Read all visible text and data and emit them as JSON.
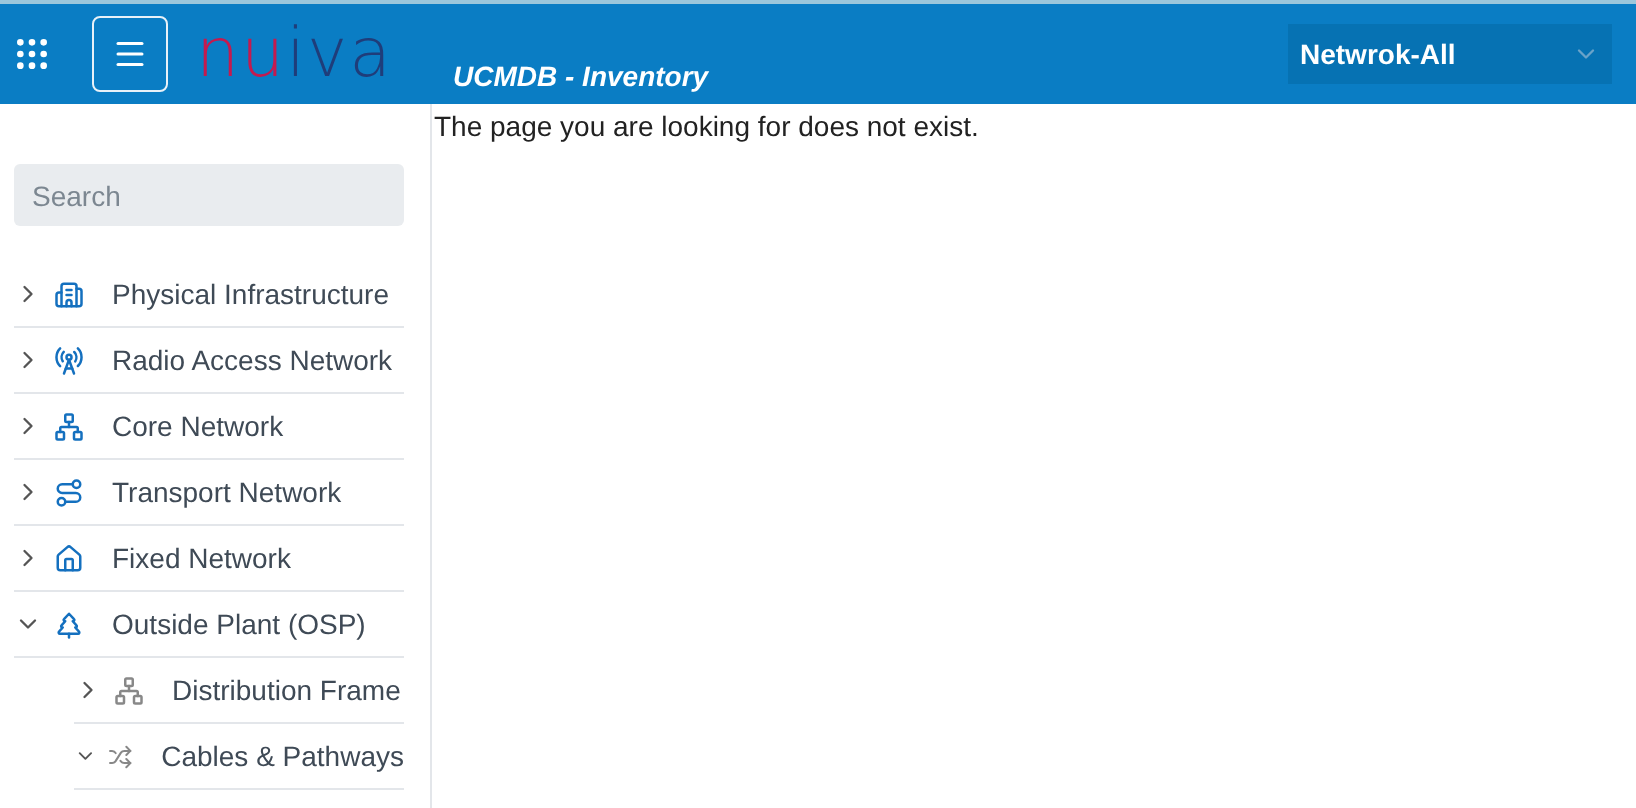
{
  "header": {
    "logo": [
      "nu",
      "iva"
    ],
    "title": "UCMDB - Inventory",
    "network_select": {
      "value": "Netwrok-All"
    }
  },
  "sidebar": {
    "search": {
      "placeholder": "Search"
    },
    "items": [
      {
        "label": "Physical Infrastructure",
        "expanded": false
      },
      {
        "label": "Radio Access Network",
        "expanded": false
      },
      {
        "label": "Core Network",
        "expanded": false
      },
      {
        "label": "Transport Network",
        "expanded": false
      },
      {
        "label": "Fixed Network",
        "expanded": false
      },
      {
        "label": "Outside Plant (OSP)",
        "expanded": true,
        "children": [
          {
            "label": "Distribution Frame",
            "expanded": false
          },
          {
            "label": "Cables & Pathways",
            "expanded": true
          }
        ]
      }
    ]
  },
  "main": {
    "message": "The page you are looking for does not exist."
  }
}
